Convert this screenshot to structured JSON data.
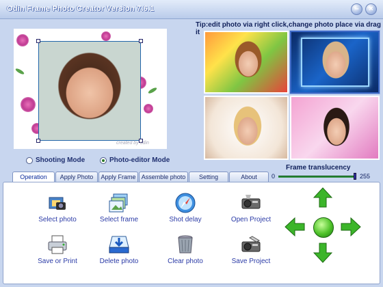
{
  "window": {
    "title": "Odin Frame Photo Creator Version 7.6.1",
    "minimize_label": "–",
    "close_label": "×"
  },
  "tip": "Tip:edit photo via right click,change photo place via drag it",
  "preview": {
    "signature": "created by odin"
  },
  "modes": [
    {
      "label": "Shooting Mode",
      "selected": false
    },
    {
      "label": "Photo-editor Mode",
      "selected": true
    }
  ],
  "translucency": {
    "label": "Frame translucency",
    "min": "0",
    "max": "255",
    "value": 255
  },
  "tabs": [
    "Operation",
    "Apply Photo",
    "Apply Frame",
    "Assemble photo",
    "Setting",
    "About"
  ],
  "active_tab": 0,
  "tools": [
    {
      "label": "Select photo",
      "icon": "camera-photo-icon"
    },
    {
      "label": "Select frame",
      "icon": "frame-stack-icon"
    },
    {
      "label": "Shot delay",
      "icon": "compass-timer-icon"
    },
    {
      "label": "Open Project",
      "icon": "projector-open-icon"
    },
    {
      "label": "Save or Print",
      "icon": "printer-icon"
    },
    {
      "label": "Delete photo",
      "icon": "delete-tray-icon"
    },
    {
      "label": "Clear photo",
      "icon": "trash-can-icon"
    },
    {
      "label": "Save Project",
      "icon": "projector-save-icon"
    }
  ],
  "nav_icons": [
    "arrow-up-icon",
    "arrow-down-icon",
    "arrow-left-icon",
    "arrow-right-icon",
    "center-button-icon"
  ],
  "colors": {
    "accent_green": "#3cb52a",
    "tab_text": "#1b2b6b",
    "label_blue": "#2a3aa6"
  }
}
